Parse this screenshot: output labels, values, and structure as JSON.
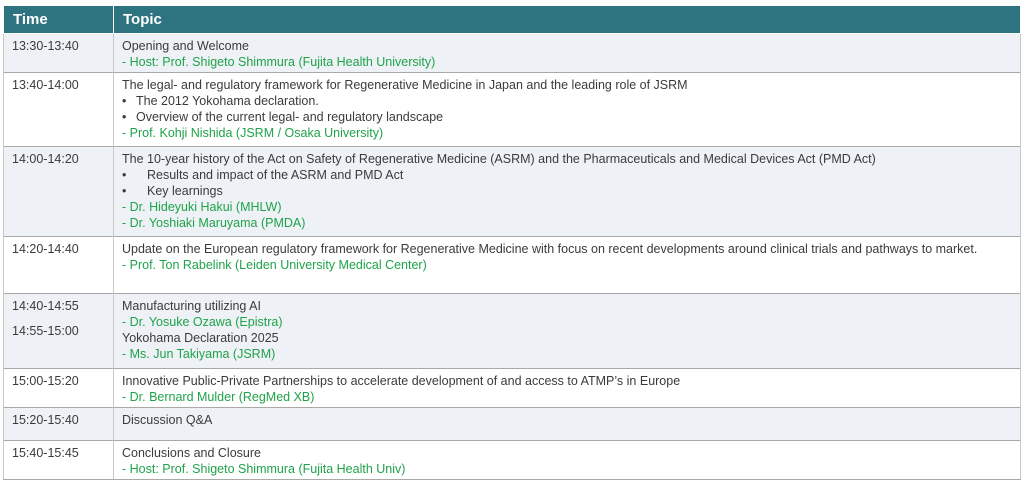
{
  "header": {
    "time": "Time",
    "topic": "Topic"
  },
  "rows": [
    {
      "time": "13:30-13:40",
      "title": "Opening and Welcome",
      "speakers": [
        "- Host: Prof. Shigeto Shimmura (Fujita Health University)"
      ]
    },
    {
      "time": "13:40-14:00",
      "title": "The legal- and regulatory framework for Regenerative Medicine in Japan and the leading role of JSRM",
      "bullets": [
        "The 2012 Yokohama declaration.",
        "Overview of the current legal- and regulatory landscape"
      ],
      "speakers": [
        "- Prof. Kohji Nishida (JSRM / Osaka University)"
      ]
    },
    {
      "time": "14:00-14:20",
      "title": "The 10-year history of the Act on Safety of Regenerative Medicine (ASRM) and the Pharmaceuticals and Medical Devices Act (PMD Act)",
      "bullets": [
        "Results and impact of the ASRM and PMD Act",
        "Key learnings"
      ],
      "speakers": [
        "- Dr. Hideyuki Hakui (MHLW)",
        "- Dr. Yoshiaki Maruyama (PMDA)"
      ]
    },
    {
      "time": "14:20-14:40",
      "title": "Update on the European regulatory framework for Regenerative Medicine with focus on recent developments around clinical trials and pathways to market.",
      "speakers": [
        "- Prof. Ton Rabelink (Leiden University Medical Center)"
      ]
    },
    {
      "time": "14:40-14:55",
      "time2": "14:55-15:00",
      "title": "Manufacturing utilizing AI",
      "speakers": [
        "- Dr. Yosuke Ozawa (Epistra)"
      ],
      "title2": "Yokohama Declaration 2025",
      "speakers2": [
        "- Ms. Jun Takiyama (JSRM)"
      ]
    },
    {
      "time": "15:00-15:20",
      "title": "Innovative Public-Private Partnerships to accelerate development of and access to ATMP’s in Europe",
      "speakers": [
        "- Dr. Bernard Mulder (RegMed XB)"
      ]
    },
    {
      "time": "15:20-15:40",
      "title": "Discussion Q&A"
    },
    {
      "time": "15:40-15:45",
      "title": "Conclusions and Closure",
      "speakers": [
        "- Host: Prof. Shigeto Shimmura (Fujita Health Univ)"
      ]
    }
  ],
  "bullet_glyph": "•",
  "colors": {
    "header_bg": "#2e7480",
    "speaker": "#1fa34a",
    "row_alt": "#eef1f5"
  }
}
